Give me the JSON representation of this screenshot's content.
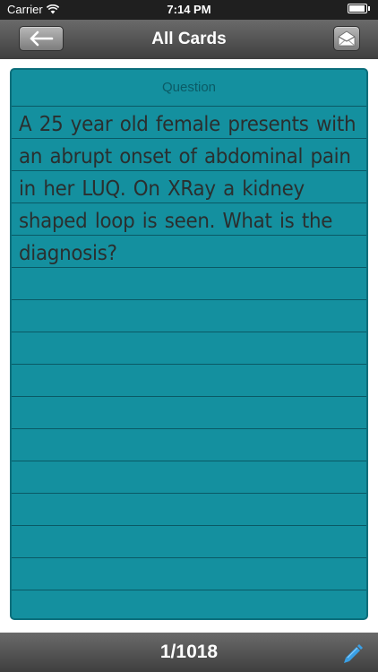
{
  "status_bar": {
    "carrier": "Carrier",
    "time": "7:14 PM"
  },
  "nav_bar": {
    "title": "All Cards",
    "back_icon": "back-arrow-icon",
    "mail_icon": "envelope-icon"
  },
  "card": {
    "header": "Question",
    "text": "A 25 year old female presents with an abrupt onset of abdominal pain in her LUQ.  On XRay a kidney shaped loop is seen.  What is the diagnosis?"
  },
  "bottom_bar": {
    "counter": "1/1018",
    "edit_icon": "pencil-icon"
  },
  "colors": {
    "card_background": "#14909f",
    "bar_background": "#4f4f4f",
    "edit_icon": "#3aa0e6"
  }
}
